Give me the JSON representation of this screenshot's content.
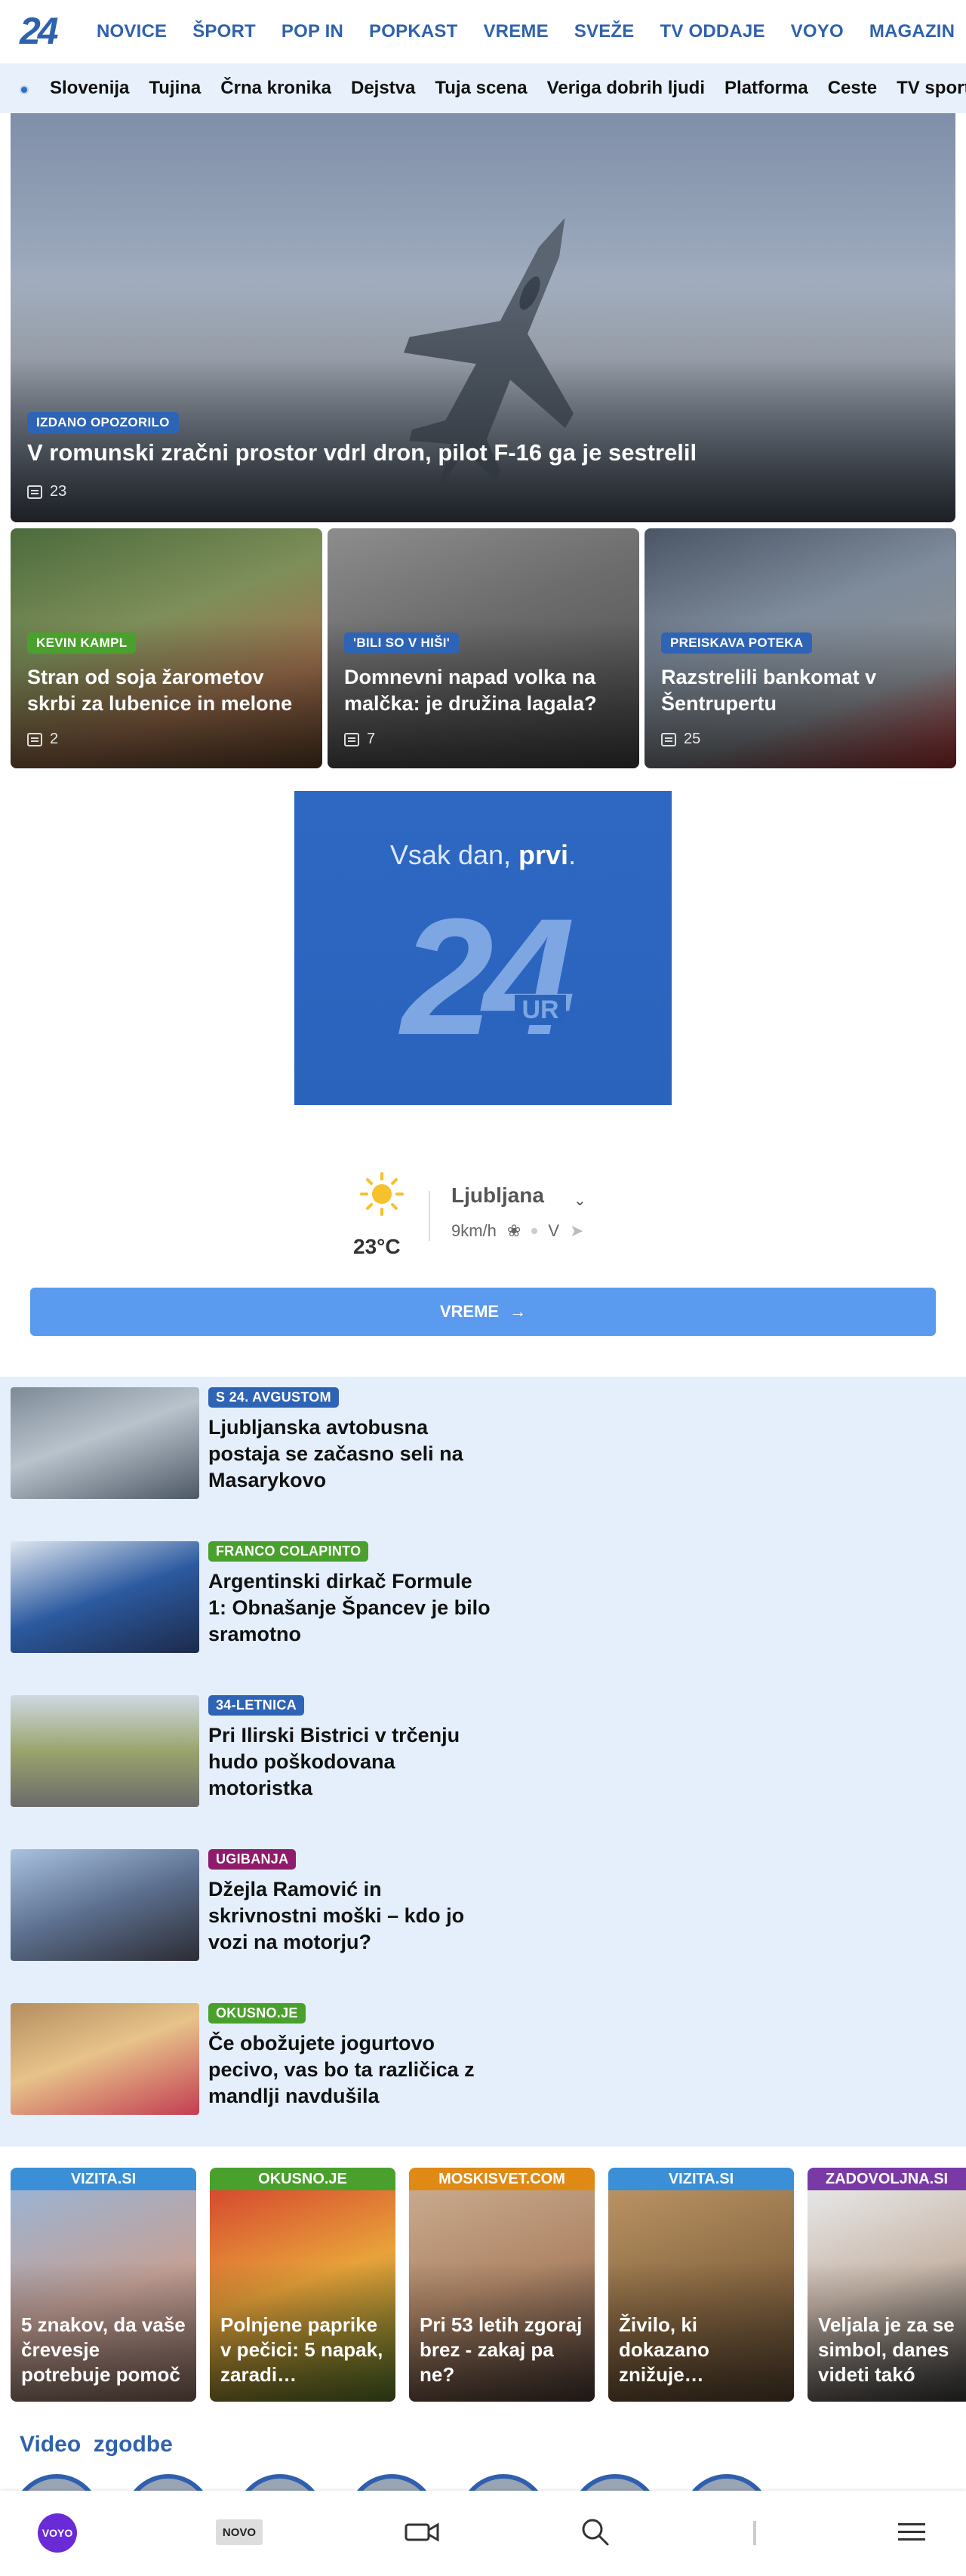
{
  "header": {
    "logo_text": "24",
    "nav": [
      "NOVICE",
      "ŠPORT",
      "POP IN",
      "POPKAST",
      "VREME",
      "SVEŽE",
      "TV ODDAJE",
      "VOYO",
      "MAGAZIN"
    ]
  },
  "subnav": [
    "Slovenija",
    "Tujina",
    "Črna kronika",
    "Dejstva",
    "Tuja scena",
    "Veriga dobrih ljudi",
    "Platforma",
    "Ceste",
    "TV sport"
  ],
  "hero": {
    "tag": "IZDANO OPOZORILO",
    "title": "V romunski zračni prostor vdrl dron, pilot F-16 ga je sestrelil",
    "comments": "23"
  },
  "cards": [
    {
      "tag": "KEVIN KAMPL",
      "tag_color": "#4aa02c",
      "title": "Stran od soja žarometov skrbi za lubenice in melone",
      "comments": "2"
    },
    {
      "tag": "'BILI SO V HIŠI'",
      "tag_color": "#2e64b5",
      "title": "Domnevni napad volka na malčka: je družina lagala?",
      "comments": "7"
    },
    {
      "tag": "PREISKAVA POTEKA",
      "tag_color": "#2e64b5",
      "title": "Razstrelili bankomat v Šentrupertu",
      "comments": "25"
    }
  ],
  "ad": {
    "slogan_plain": "Vsak dan, ",
    "slogan_bold": "prvi",
    "slogan_end": ".",
    "logo_number": "24",
    "logo_suffix": "UR"
  },
  "weather": {
    "temperature": "23°C",
    "city": "Ljubljana",
    "wind_speed": "9km/h",
    "wind_dir": "V",
    "button_label": "VREME"
  },
  "news": [
    {
      "tag": "S 24. AVGUSTOM",
      "tag_color": "#2e64b5",
      "title": "Ljubljanska avtobusna postaja se začasno seli na Masarykovo"
    },
    {
      "tag": "FRANCO COLAPINTO",
      "tag_color": "#4aa02c",
      "title": "Argentinski dirkač Formule 1: Obnašanje Špancev je bilo sramotno"
    },
    {
      "tag": "34-LETNICA",
      "tag_color": "#2e64b5",
      "title": "Pri Ilirski Bistrici v trčenju hudo poškodovana motoristka"
    },
    {
      "tag": "UGIBANJA",
      "tag_color": "#8e1b6b",
      "title": "Džejla Ramović in skrivnostni moški – kdo jo vozi na motorju?"
    },
    {
      "tag": "OKUSNO.JE",
      "tag_color": "#4aa02c",
      "title": "Če obožujete jogurtovo pecivo, vas bo ta različica z mandlji navdušila"
    }
  ],
  "partners": [
    {
      "source": "VIZITA.SI",
      "color": "#3b8fd6",
      "title": "5 znakov, da vaše črevesje potrebuje pomoč"
    },
    {
      "source": "OKUSNO.JE",
      "color": "#4aa02c",
      "title": "Polnjene paprike v pečici: 5 napak, zaradi…"
    },
    {
      "source": "MOSKISVET.COM",
      "color": "#e08a16",
      "title": "Pri 53 letih zgoraj brez - zakaj pa ne?"
    },
    {
      "source": "VIZITA.SI",
      "color": "#3b8fd6",
      "title": "Živilo, ki dokazano znižuje…"
    },
    {
      "source": "ZADOVOLJNA.SI",
      "color": "#7a3aa6",
      "title": "Veljala je za se simbol, danes videti takó"
    }
  ],
  "video": {
    "title": "Video  zgodbe"
  },
  "bottomnav": {
    "voyo": "VOYO",
    "novo": "NOVO"
  }
}
